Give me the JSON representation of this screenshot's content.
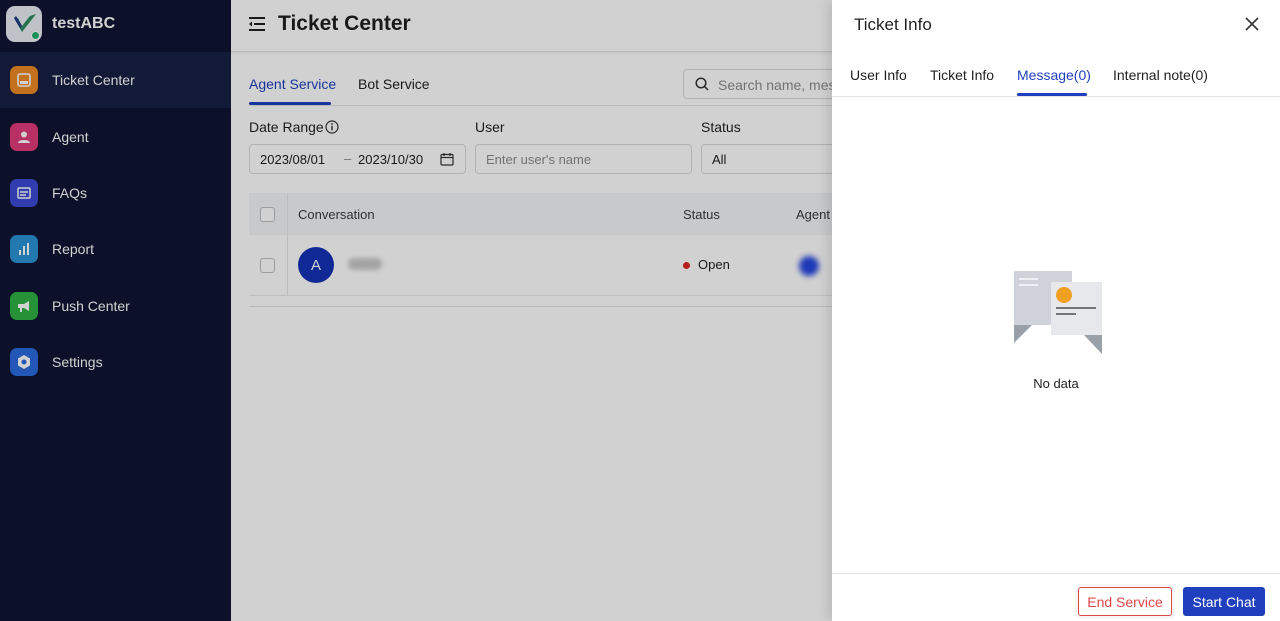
{
  "app": {
    "name": "testABC"
  },
  "sidebar": {
    "items": [
      {
        "label": "Ticket Center",
        "icon": "ticket-icon",
        "color": "#f08a24",
        "active": true
      },
      {
        "label": "Agent",
        "icon": "agent-icon",
        "color": "#e23b7a",
        "active": false
      },
      {
        "label": "FAQs",
        "icon": "faq-icon",
        "color": "#3c4bd6",
        "active": false
      },
      {
        "label": "Report",
        "icon": "report-icon",
        "color": "#2a94d6",
        "active": false
      },
      {
        "label": "Push Center",
        "icon": "megaphone-icon",
        "color": "#2fb344",
        "active": false
      },
      {
        "label": "Settings",
        "icon": "gear-icon",
        "color": "#2a6be0",
        "active": false
      }
    ]
  },
  "header": {
    "title": "Ticket Center"
  },
  "main_tabs": [
    {
      "label": "Agent Service",
      "active": true
    },
    {
      "label": "Bot Service",
      "active": false
    }
  ],
  "search": {
    "placeholder": "Search name, mess"
  },
  "filters": {
    "date_range": {
      "label": "Date Range",
      "start": "2023/08/01",
      "separator": "–",
      "end": "2023/10/30"
    },
    "user": {
      "label": "User",
      "placeholder": "Enter user's name"
    },
    "status": {
      "label": "Status",
      "value": "All"
    }
  },
  "table": {
    "headers": [
      "Conversation",
      "Status",
      "Agent"
    ],
    "rows": [
      {
        "avatar_letter": "A",
        "status": "Open"
      }
    ]
  },
  "drawer": {
    "title": "Ticket Info",
    "tabs": [
      {
        "label": "User Info",
        "active": false
      },
      {
        "label": "Ticket Info",
        "active": false
      },
      {
        "label": "Message(0)",
        "active": true
      },
      {
        "label": "Internal note(0)",
        "active": false
      }
    ],
    "empty_text": "No data",
    "buttons": {
      "end": "End Service",
      "start": "Start Chat"
    }
  },
  "colors": {
    "accent": "#1f3fbf",
    "sidebar_bg": "#0f1431",
    "danger": "#e04848",
    "status_open": "#e02424"
  }
}
